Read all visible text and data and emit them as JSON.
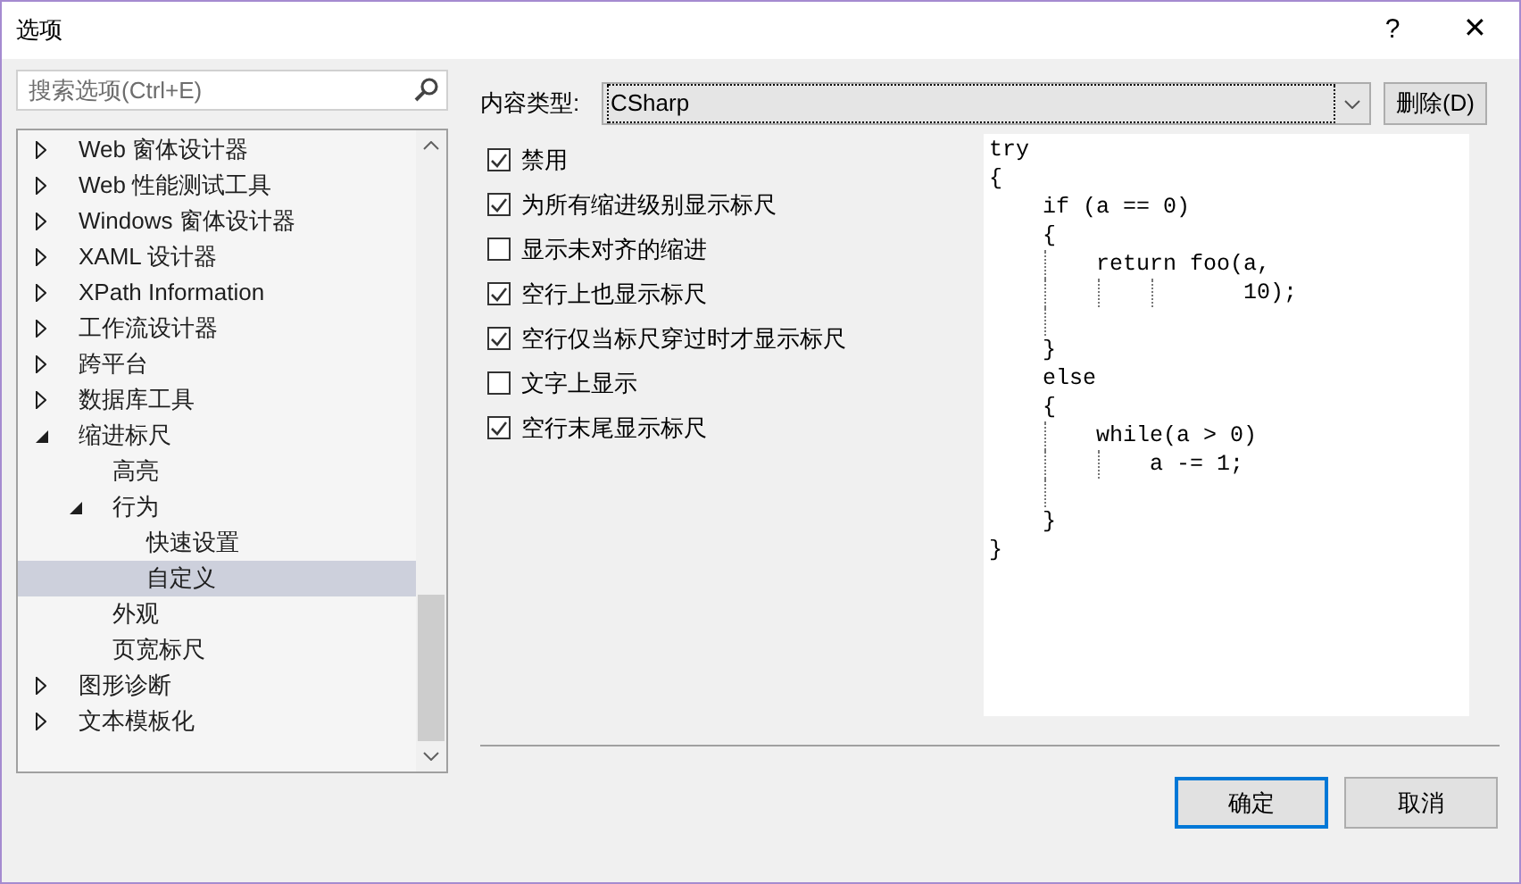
{
  "window": {
    "title": "选项",
    "help": "?",
    "close": "✕"
  },
  "search": {
    "placeholder": "搜索选项(Ctrl+E)"
  },
  "tree": [
    {
      "label": "Web 窗体设计器",
      "expanded": false,
      "selected": false
    },
    {
      "label": "Web 性能测试工具",
      "expanded": false,
      "selected": false
    },
    {
      "label": "Windows 窗体设计器",
      "expanded": false,
      "selected": false
    },
    {
      "label": "XAML 设计器",
      "expanded": false,
      "selected": false
    },
    {
      "label": "XPath Information",
      "expanded": false,
      "selected": false
    },
    {
      "label": "工作流设计器",
      "expanded": false,
      "selected": false
    },
    {
      "label": "跨平台",
      "expanded": false,
      "selected": false
    },
    {
      "label": "数据库工具",
      "expanded": false,
      "selected": false
    },
    {
      "label": "缩进标尺",
      "expanded": true,
      "selected": false,
      "children": [
        {
          "label": "高亮",
          "selected": false
        },
        {
          "label": "行为",
          "expanded": true,
          "selected": false,
          "children": [
            {
              "label": "快速设置",
              "selected": false
            },
            {
              "label": "自定义",
              "selected": true
            }
          ]
        },
        {
          "label": "外观",
          "selected": false
        },
        {
          "label": "页宽标尺",
          "selected": false
        }
      ]
    },
    {
      "label": "图形诊断",
      "expanded": false,
      "selected": false
    },
    {
      "label": "文本模板化",
      "expanded": false,
      "selected": false
    }
  ],
  "content_type": {
    "label": "内容类型:",
    "value": "CSharp",
    "delete_button": "删除(D)"
  },
  "options": [
    {
      "label": "禁用",
      "checked": true
    },
    {
      "label": "为所有缩进级别显示标尺",
      "checked": true
    },
    {
      "label": "显示未对齐的缩进",
      "checked": false
    },
    {
      "label": "空行上也显示标尺",
      "checked": true
    },
    {
      "label": "空行仅当标尺穿过时才显示标尺",
      "checked": true
    },
    {
      "label": "文字上显示",
      "checked": false
    },
    {
      "label": "空行末尾显示标尺",
      "checked": true
    }
  ],
  "preview": [
    {
      "kind": "code",
      "text": "try"
    },
    {
      "kind": "code",
      "text": "{"
    },
    {
      "kind": "code",
      "text": "    if (a == 0)"
    },
    {
      "kind": "code",
      "text": "    {"
    },
    {
      "kind": "code",
      "text": "        return foo(a,"
    },
    {
      "kind": "code",
      "text": "                   10);"
    },
    {
      "kind": "blank"
    },
    {
      "kind": "code",
      "text": "    }"
    },
    {
      "kind": "code",
      "text": "    else"
    },
    {
      "kind": "code",
      "text": "    {"
    },
    {
      "kind": "code",
      "text": "        while(a > 0)"
    },
    {
      "kind": "code",
      "text": "            a -= 1;"
    },
    {
      "kind": "blank"
    },
    {
      "kind": "code",
      "text": "    }"
    },
    {
      "kind": "code",
      "text": "}"
    }
  ],
  "buttons": {
    "ok": "确定",
    "cancel": "取消"
  }
}
